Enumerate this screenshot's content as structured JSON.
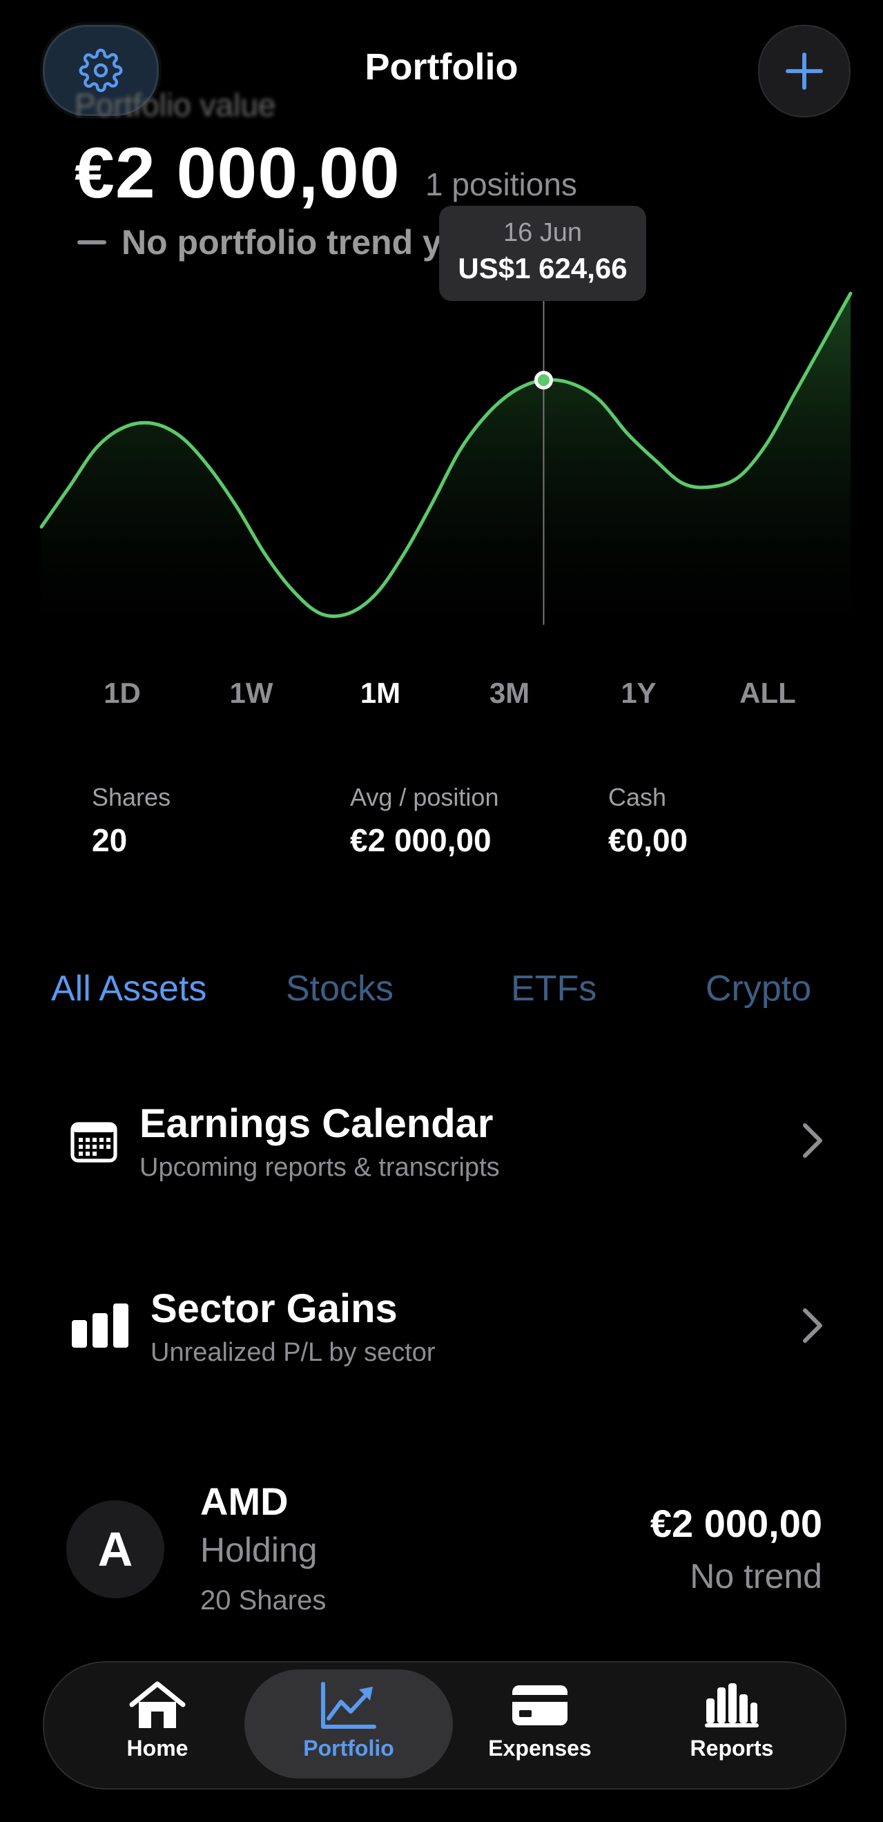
{
  "header": {
    "title": "Portfolio",
    "settings_icon": "gear-icon",
    "add_icon": "plus-icon"
  },
  "summary": {
    "faded_label": "Portfolio value",
    "value": "€2 000,00",
    "positions": "1 positions",
    "trend_text": "No portfolio trend y"
  },
  "tooltip": {
    "date": "16 Jun",
    "price": "US$1 624,66"
  },
  "chart_data": {
    "type": "area",
    "points": [
      0.3,
      0.42,
      0.54,
      0.6,
      0.61,
      0.57,
      0.48,
      0.36,
      0.22,
      0.11,
      0.04,
      0.04,
      0.1,
      0.22,
      0.37,
      0.53,
      0.64,
      0.71,
      0.74,
      0.73,
      0.68,
      0.58,
      0.5,
      0.43,
      0.42,
      0.45,
      0.55,
      0.7,
      0.85,
      1.0
    ],
    "highlight_index": 18,
    "line_color": "#5cc96a"
  },
  "ranges": [
    "1D",
    "1W",
    "1M",
    "3M",
    "1Y",
    "ALL"
  ],
  "active_range": "1M",
  "stats": {
    "shares_label": "Shares",
    "shares_value": "20",
    "avg_label": "Avg / position",
    "avg_value": "€2 000,00",
    "cash_label": "Cash",
    "cash_value": "€0,00"
  },
  "asset_tabs": [
    "All Assets",
    "Stocks",
    "ETFs",
    "Crypto"
  ],
  "earnings": {
    "title": "Earnings Calendar",
    "subtitle": "Upcoming reports & transcripts",
    "icon": "calendar-icon"
  },
  "sectors": {
    "title": "Sector Gains",
    "subtitle": "Unrealized P/L by sector",
    "icon": "bar-chart-icon"
  },
  "holding": {
    "avatar_letter": "A",
    "symbol": "AMD",
    "type": "Holding",
    "shares": "20 Shares",
    "value": "€2 000,00",
    "trend": "No trend"
  },
  "tabbar": {
    "home": "Home",
    "portfolio": "Portfolio",
    "expenses": "Expenses",
    "reports": "Reports"
  },
  "colors": {
    "accent": "#5a9af0",
    "inactive_tab": "#3c5e86",
    "chart_line": "#5cc96a"
  }
}
